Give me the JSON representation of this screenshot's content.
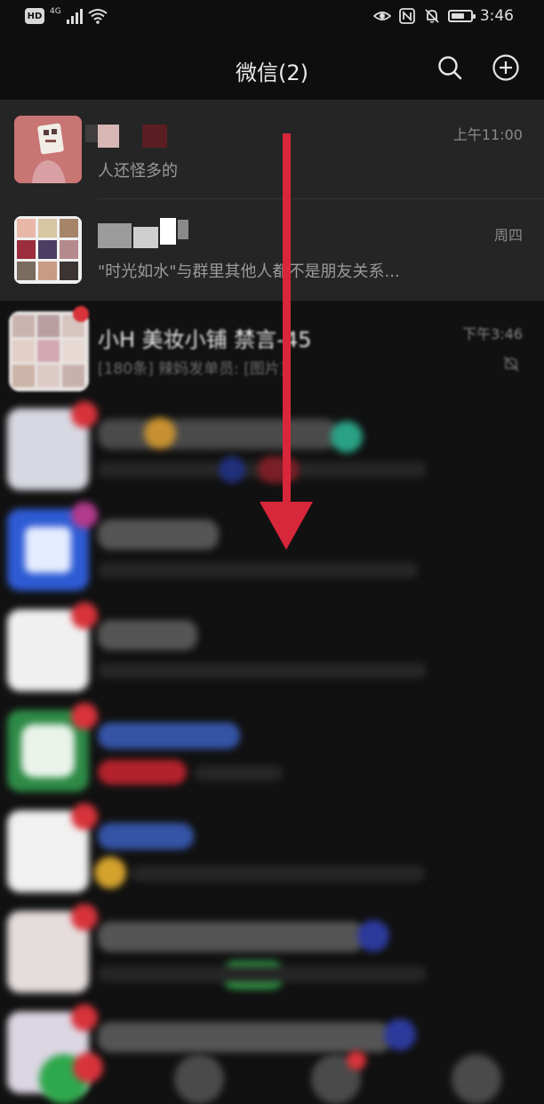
{
  "status_bar": {
    "hd": "HD",
    "network": "4G",
    "time": "3:46",
    "battery_level": 0.7
  },
  "header": {
    "title": "微信(2)",
    "search_icon": "search-icon",
    "add_icon": "plus-circle-icon"
  },
  "chats": [
    {
      "preview": "人还怪多的",
      "time": "上午11:00",
      "pinned": true
    },
    {
      "preview": "\"时光如水\"与群里其他人都不是朋友关系...",
      "time": "周四",
      "pinned": true
    },
    {
      "name": "小H 美妆小铺 禁言-45",
      "preview": "[180条] 辣妈发单员: [图片]",
      "time": "下午3:46",
      "muted": true,
      "unread_dot": true
    }
  ],
  "colors": {
    "background": "#111111",
    "pinned_background": "#252525",
    "arrow": "#d8263a",
    "badge": "#d8333b"
  }
}
